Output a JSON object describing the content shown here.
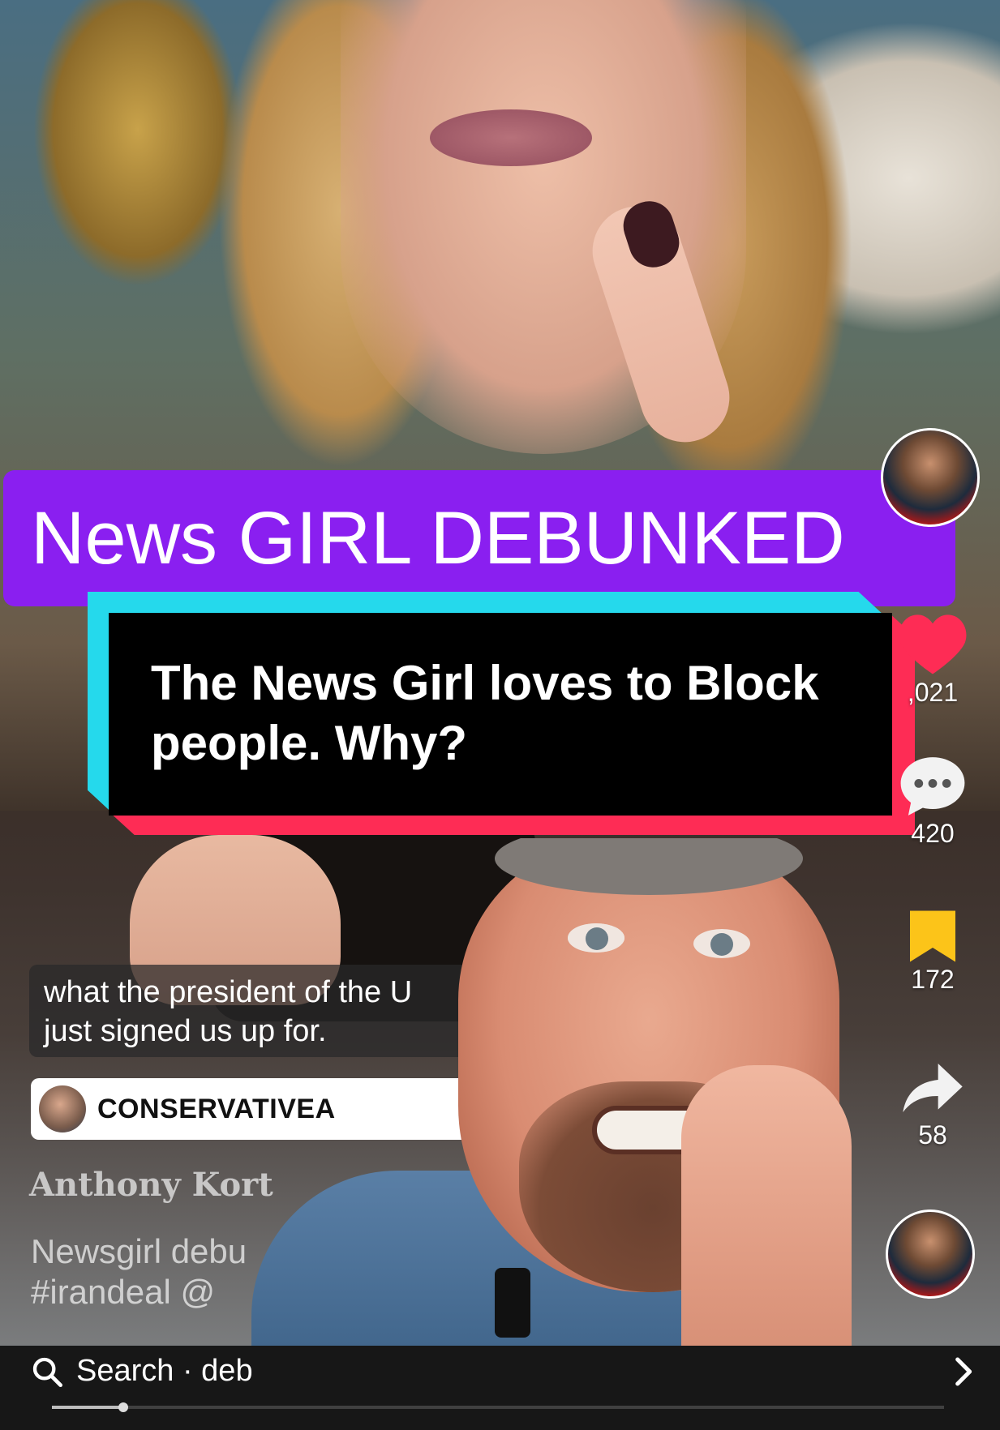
{
  "video": {
    "banner_title": "News GIRL DEBUNKED",
    "caption_line1": "The News Girl loves to Block",
    "caption_line2": "people. Why?",
    "subtitle_line1": "what the president of the U",
    "subtitle_line2": "just signed us up for.",
    "creator_chip_name": "CONSERVATIVEA",
    "username": "Anthony Kort",
    "description_line1": "Newsgirl debu",
    "description_line2": "#irandeal @",
    "playback_progress": 0.08
  },
  "actions": {
    "likes": ",021",
    "comments": "420",
    "bookmarks": "172",
    "shares": "58",
    "like_color": "#fe2c55",
    "bookmark_color": "#fcc419"
  },
  "search": {
    "text": "Search · deb"
  },
  "colors": {
    "banner_bg": "#8a1ff0",
    "glitch_cyan": "#25d9ec",
    "glitch_red": "#fe2c55"
  }
}
